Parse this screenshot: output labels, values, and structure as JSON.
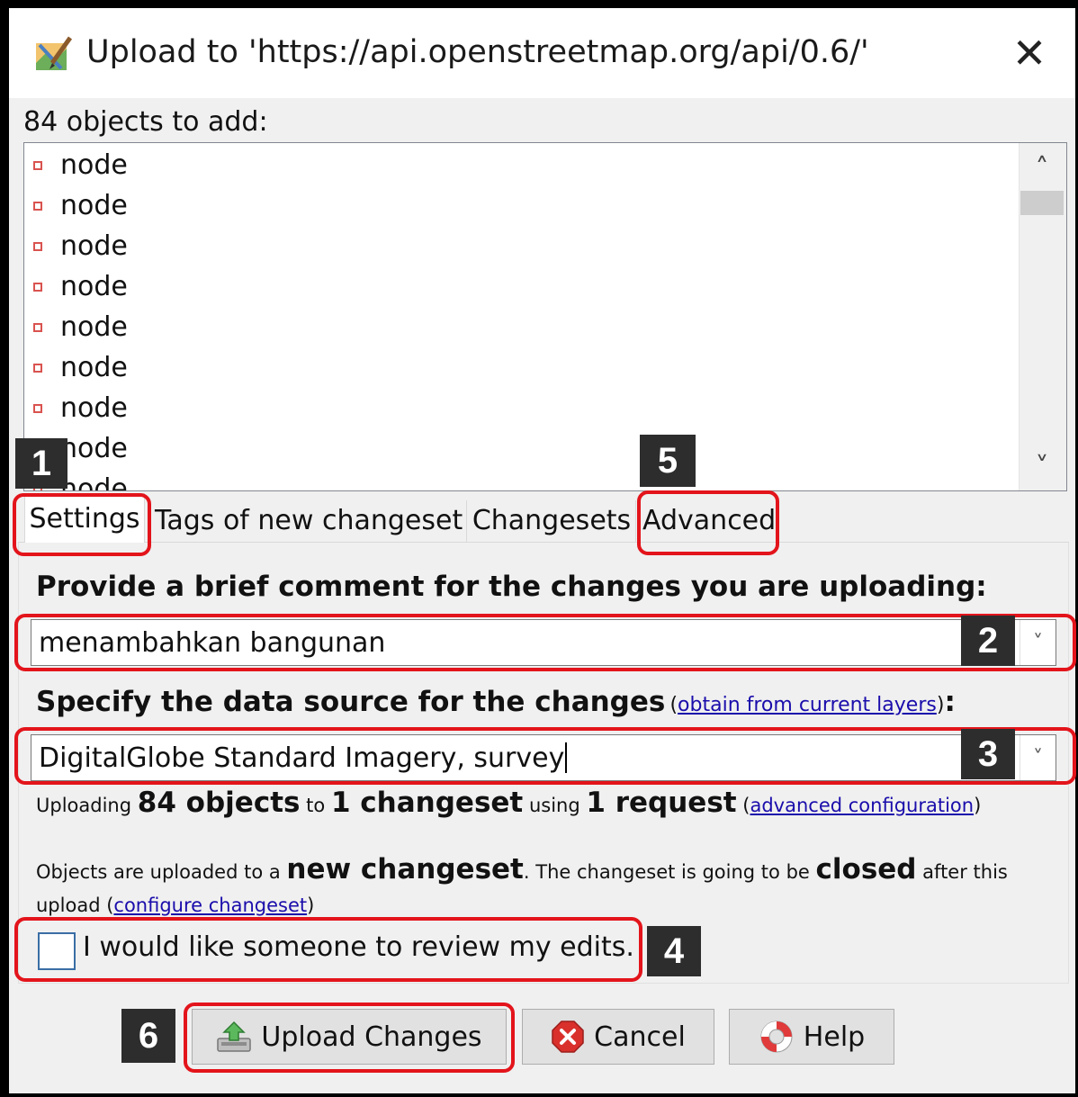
{
  "window": {
    "title": "Upload to 'https://api.openstreetmap.org/api/0.6/'"
  },
  "objects": {
    "count_label": "84 objects to add:",
    "items": [
      "node",
      "node",
      "node",
      "node",
      "node",
      "node",
      "node",
      "node",
      "node"
    ]
  },
  "tabs": [
    {
      "label": "Settings",
      "selected": true
    },
    {
      "label": "Tags of new changeset",
      "selected": false
    },
    {
      "label": "Changesets",
      "selected": false
    },
    {
      "label": "Advanced",
      "selected": false
    }
  ],
  "settings": {
    "comment_heading": "Provide a brief comment for the changes you are uploading:",
    "comment_value": "menambahkan bangunan",
    "source_heading": "Specify the data source for the changes",
    "source_link": "obtain from current layers",
    "source_value": "DigitalGlobe Standard Imagery, survey",
    "summary": {
      "t1": "Uploading",
      "objects": "84 objects",
      "t2": "to",
      "changeset": "1 changeset",
      "t3": "using",
      "request": "1 request",
      "link": "advanced configuration"
    },
    "close_info": {
      "t1": "Objects are uploaded to a",
      "new_changeset": "new changeset",
      "t2": ". The changeset is going to be",
      "closed": "closed",
      "t3": "after this",
      "t4": "upload",
      "link": "configure changeset"
    },
    "review_label": "I would like someone to review my edits.",
    "review_checked": false
  },
  "buttons": {
    "upload": "Upload Changes",
    "cancel": "Cancel",
    "help": "Help"
  },
  "annotations": [
    "1",
    "2",
    "3",
    "4",
    "5",
    "6"
  ],
  "colors": {
    "highlight": "#e3141b",
    "badge": "#2d2d2d",
    "link": "#1a0dab",
    "node_marker": "#d9534f"
  }
}
